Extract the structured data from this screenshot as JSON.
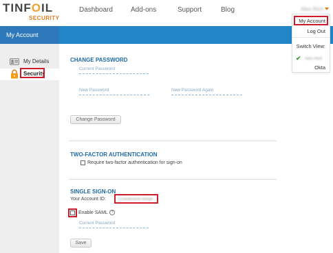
{
  "brand": {
    "name_main": "TINF",
    "name_o": "O",
    "name_end": "IL",
    "name_sub": "SECURITY"
  },
  "nav": {
    "links": [
      "Dashboard",
      "Add-ons",
      "Support",
      "Blog"
    ],
    "user_name": "Alex Rich"
  },
  "header": {
    "title": "My Account"
  },
  "sidebar": {
    "items": [
      {
        "label": "My Details",
        "icon": "id-card-icon"
      },
      {
        "label": "Security",
        "icon": "lock-icon"
      }
    ]
  },
  "change_password": {
    "title": "CHANGE PASSWORD",
    "current_placeholder": "Current Password",
    "new_placeholder": "New Password",
    "new_again_placeholder": "New Password Again",
    "button_label": "Change Password"
  },
  "two_factor": {
    "title": "TWO-FACTOR AUTHENTICATION",
    "checkbox_label": "Require two-factor authentication for sign-on"
  },
  "sso": {
    "title": "SINGLE SIGN-ON",
    "account_id_label": "Your Account ID:",
    "account_id_value": "1234abcd5678efgh",
    "enable_saml_label": "Enable SAML",
    "help_symbol": "?",
    "password_placeholder": "Current Password",
    "save_label": "Save"
  },
  "dropdown": {
    "items": [
      "My Account",
      "Log Out"
    ],
    "switch_view_label": "Switch View:",
    "switch_current": "Alex Rich",
    "switch_other": "Okta"
  },
  "colors": {
    "header_blue": "#2185c8",
    "section_title": "#1e6aa8",
    "highlight_red": "#cc1b2a",
    "brand_orange": "#e07b20"
  }
}
